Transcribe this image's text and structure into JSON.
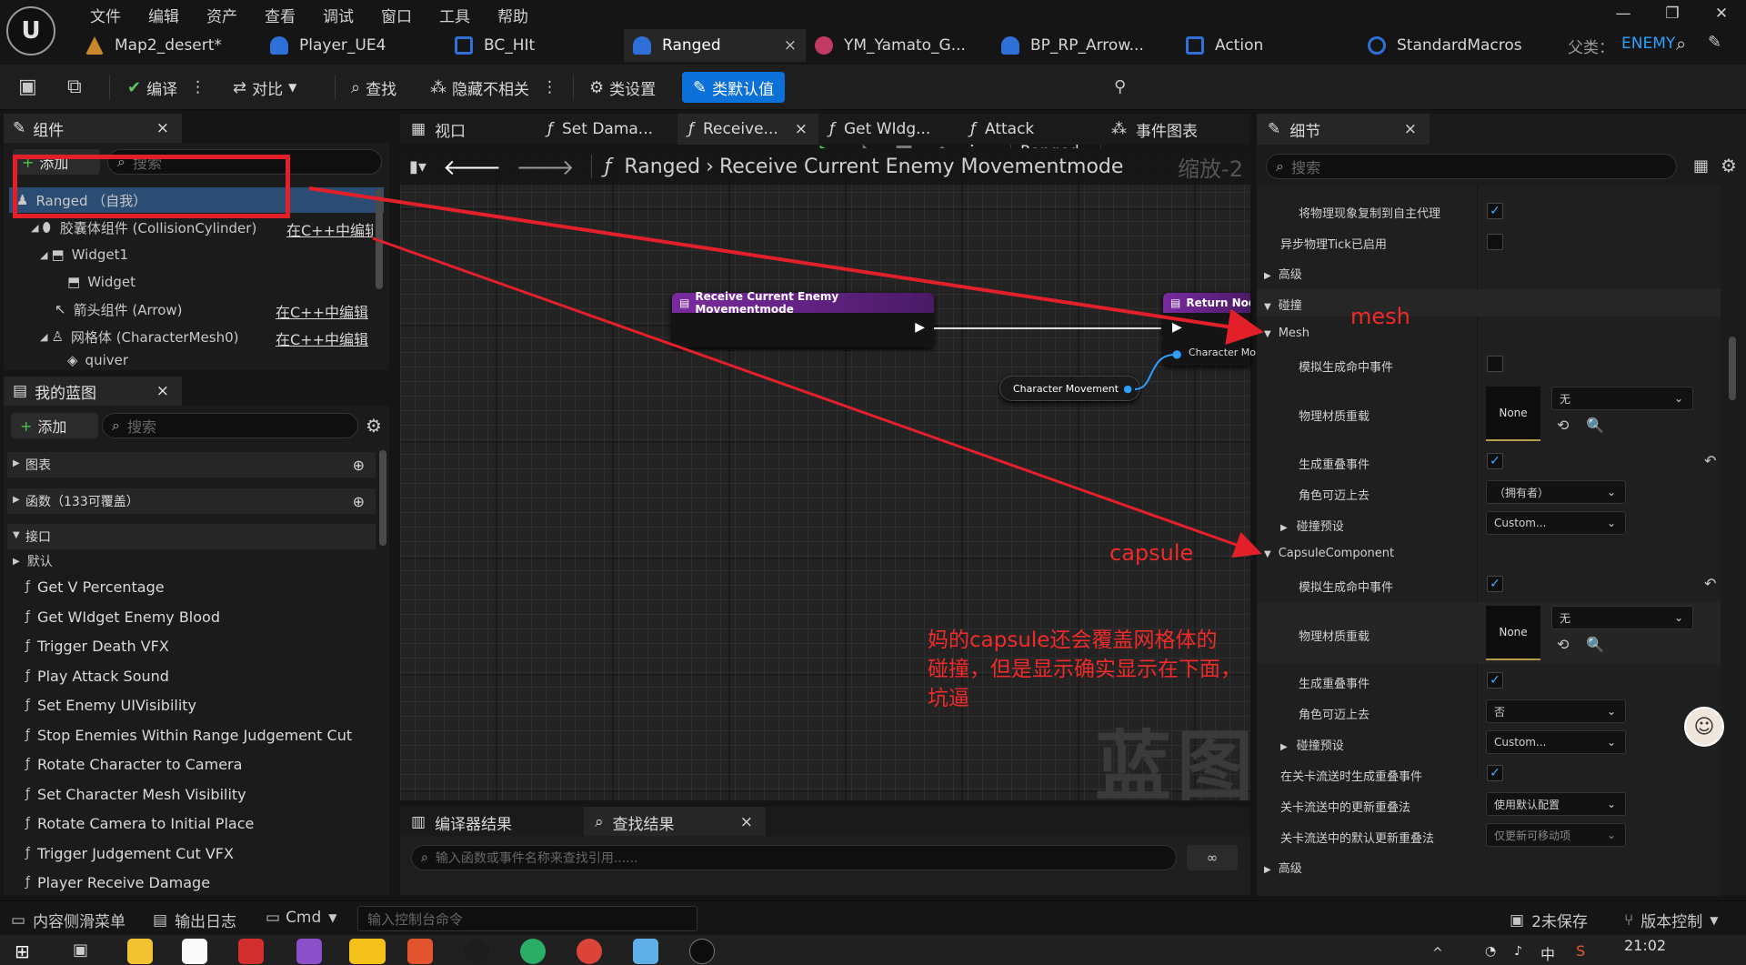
{
  "menu": [
    "文件",
    "编辑",
    "资产",
    "查看",
    "调试",
    "窗口",
    "工具",
    "帮助"
  ],
  "tabs": [
    {
      "label": "Map2_desert*",
      "color": "#c9862a"
    },
    {
      "label": "Player_UE4",
      "color": "#2e6fd8"
    },
    {
      "label": "BC_HIt",
      "color": "#2e6fd8"
    },
    {
      "label": "Ranged",
      "color": "#2e6fd8",
      "active": true,
      "close": "×"
    },
    {
      "label": "YM_Yamato_G...",
      "color": "#c23a64"
    },
    {
      "label": "BP_RP_Arrow...",
      "color": "#2e6fd8"
    },
    {
      "label": "Action",
      "color": "#2e6fd8"
    },
    {
      "label": "StandardMacros",
      "color": "#2e6fd8"
    }
  ],
  "parent": {
    "label": "父类：",
    "value": "ENEMY"
  },
  "toolbar": {
    "compile": "编译",
    "diff": "对比",
    "find": "查找",
    "hide": "隐藏不相关",
    "class_settings": "类设置",
    "class_defaults": "类默认值",
    "debug_target": "Ranged"
  },
  "components": {
    "title": "组件",
    "add": "添加",
    "search_placeholder": "搜索",
    "items": [
      {
        "name": "Ranged （自我）"
      },
      {
        "name": "胶囊体组件 (CollisionCylinder)",
        "edit": "在C++中编辑"
      },
      {
        "name": "Widget1"
      },
      {
        "name": "Widget"
      },
      {
        "name": "箭头组件 (Arrow)",
        "edit": "在C++中编辑"
      },
      {
        "name": "网格体 (CharacterMesh0)",
        "edit": "在C++中编辑"
      },
      {
        "name": "quiver"
      }
    ]
  },
  "myblueprint": {
    "title": "我的蓝图",
    "add": "添加",
    "search_placeholder": "搜索",
    "sections": {
      "graphs": "图表",
      "functions": "函数（133可覆盖）",
      "interfaces": "接口",
      "default": "默认"
    },
    "functions": [
      "Get V Percentage",
      "Get WIdget Enemy Blood",
      "Trigger Death VFX",
      "Play Attack Sound",
      "Set Enemy UIVisibility",
      "Stop Enemies Within Range Judgement Cut",
      "Rotate Character to Camera",
      "Set Character Mesh Visibility",
      "Rotate Camera to Initial Place",
      "Trigger Judgement Cut VFX",
      "Player Receive Damage"
    ]
  },
  "graph_tabs": [
    {
      "label": "视口"
    },
    {
      "label": "Set Dama..."
    },
    {
      "label": "Receive...",
      "active": true,
      "close": "×"
    },
    {
      "label": "Get WIdg..."
    },
    {
      "label": "Attack"
    },
    {
      "label": "事件图表"
    }
  ],
  "breadcrumb": {
    "root": "Ranged",
    "current": "Receive Current Enemy Movementmode",
    "zoom": "缩放-2"
  },
  "nodes": {
    "entry": "Receive Current Enemy Movementmode",
    "return": "Return Node",
    "return_pin": "Character Mo",
    "var": "Character Movement"
  },
  "watermark": "蓝图",
  "compile": {
    "results": "编译器结果",
    "find": "查找结果",
    "close": "×",
    "search_placeholder": "输入函数或事件名称来查找引用......"
  },
  "details": {
    "title": "细节",
    "search_placeholder": "搜索",
    "rows": {
      "replicate": "将物理现象复制到自主代理",
      "async_tick": "异步物理Tick已启用",
      "advanced": "高级",
      "collision": "碰撞",
      "mesh": "Mesh",
      "sim_hit": "模拟生成命中事件",
      "phys_mat": "物理材质重载",
      "none": "None",
      "wu": "无",
      "gen_overlap": "生成重叠事件",
      "step_up": "角色可迈上去",
      "step_owner": "（拥有者）",
      "preset": "碰撞预设",
      "custom": "Custom...",
      "capsule": "CapsuleComponent",
      "step_no": "否",
      "level_stream": "在关卡流送时生成重叠事件",
      "update_method": "关卡流送中的更新重叠法",
      "update_val": "使用默认配置",
      "default_update": "关卡流送中的默认更新重叠法",
      "default_val": "仅更新可移动项",
      "advanced2": "高级"
    }
  },
  "annotations": {
    "mesh": "mesh",
    "capsule": "capsule",
    "note": [
      "妈的capsule还会覆盖网格体的",
      "碰撞，但是显示确实显示在下面，",
      "坑逼"
    ]
  },
  "status": {
    "drawer": "内容侧滑菜单",
    "output": "输出日志",
    "cmd": "Cmd",
    "console_placeholder": "输入控制台命令",
    "unsaved": "2未保存",
    "source": "版本控制"
  },
  "taskbar": {
    "time": "21:02",
    "ime": "中"
  }
}
